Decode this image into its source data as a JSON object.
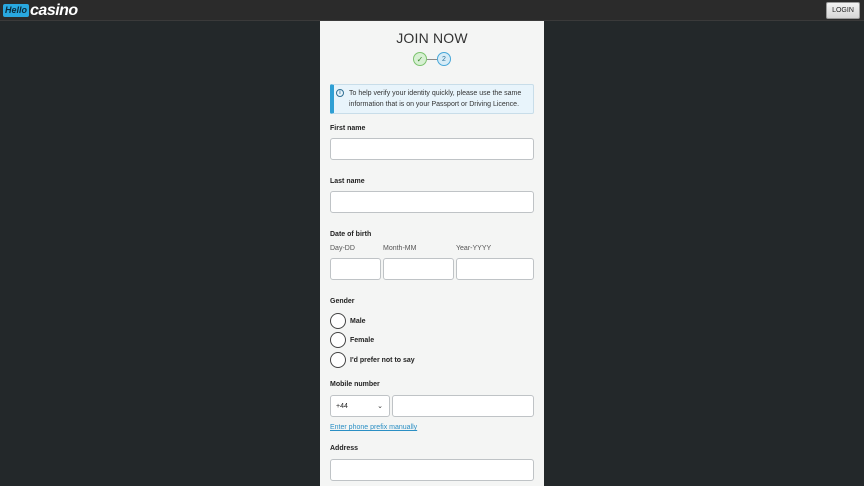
{
  "header": {
    "logo_hello": "Hello",
    "logo_casino": "casino",
    "login_label": "LOGIN"
  },
  "form": {
    "title": "JOIN NOW",
    "steps": {
      "done_icon": "check-icon",
      "current_label": "2"
    },
    "info": {
      "icon": "info-icon",
      "text": "To help verify your identity quickly, please use the same information that is on your Passport or Driving Licence."
    },
    "first_name": {
      "label": "First name",
      "value": ""
    },
    "last_name": {
      "label": "Last name",
      "value": ""
    },
    "dob": {
      "label": "Date of birth",
      "day_label": "Day-DD",
      "month_label": "Month-MM",
      "year_label": "Year-YYYY"
    },
    "gender": {
      "label": "Gender",
      "options": [
        "Male",
        "Female",
        "I'd prefer not to say"
      ]
    },
    "mobile": {
      "label": "Mobile number",
      "prefix": "+44",
      "value": "",
      "manual_link": "Enter phone prefix manually"
    },
    "address": {
      "label": "Address",
      "value": ""
    }
  },
  "colors": {
    "background": "#23282a",
    "panel": "#f4f5f4",
    "accent": "#2f9fd4",
    "success": "#7cc36e"
  }
}
